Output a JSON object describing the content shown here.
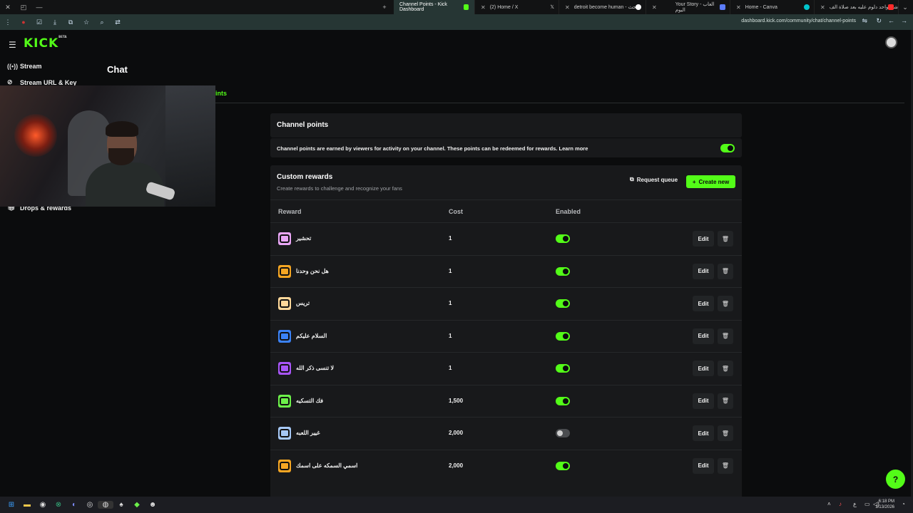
{
  "browser": {
    "tabs": [
      {
        "label": "Channel Points - Kick Dashboard",
        "active": true,
        "favicon_color": "#53fc18"
      },
      {
        "label": "(2) Home / X",
        "active": false,
        "favicon_color": "#ffffff"
      },
      {
        "label": "detroit become human - بحث",
        "active": false,
        "favicon_color": "#ffffff"
      },
      {
        "label": "Your Story - العاب اليوم",
        "active": false,
        "favicon_color": "#5b7cfa"
      },
      {
        "label": "Home - Canva",
        "active": false,
        "favicon_color": "#00c4cc"
      },
      {
        "label": "شرا واحد دلوم عليه بعد صلاة الف...",
        "active": false,
        "favicon_color": "#ff2a2a"
      }
    ],
    "new_tab": "+",
    "url": "dashboard.kick.com/community/chat/channel-points"
  },
  "app": {
    "logo": "KICK",
    "logo_badge": "BETA",
    "accent": "#53fc18",
    "sidebar": {
      "items": [
        {
          "label": "Stream",
          "icon": "broadcast-icon"
        },
        {
          "label": "Stream URL & Key",
          "icon": "link-icon"
        },
        {
          "label": "Drops & rewards",
          "icon": "gift-icon"
        }
      ]
    },
    "page_title": "Chat",
    "active_tab_label": "ints"
  },
  "channel_points": {
    "title": "Channel points",
    "description": "Channel points are earned by viewers for activity on your channel. These points can be redeemed for rewards. Learn more",
    "enabled": true
  },
  "custom_rewards": {
    "title": "Custom rewards",
    "subtitle": "Create rewards to challenge and recognize your fans",
    "request_queue_label": "Request queue",
    "create_label": "Create new",
    "columns": {
      "reward": "Reward",
      "cost": "Cost",
      "enabled": "Enabled"
    },
    "edit_label": "Edit",
    "rows": [
      {
        "name": "تحشير",
        "cost": "1",
        "enabled": true,
        "color": "#e9a6f5"
      },
      {
        "name": "هل نحن وحدنا",
        "cost": "1",
        "enabled": true,
        "color": "#f5a623"
      },
      {
        "name": "تريس",
        "cost": "1",
        "enabled": true,
        "color": "#ffd89a"
      },
      {
        "name": "السلام عليكم",
        "cost": "1",
        "enabled": true,
        "color": "#3b82f6"
      },
      {
        "name": "لا تنسى ذكر الله",
        "cost": "1",
        "enabled": true,
        "color": "#a855f7"
      },
      {
        "name": "فك التسكيه",
        "cost": "1,500",
        "enabled": true,
        "color": "#6cf04a"
      },
      {
        "name": "غيير اللعبه",
        "cost": "2,000",
        "enabled": false,
        "color": "#a6c8f5"
      },
      {
        "name": "اسمي السمكه على اسمك",
        "cost": "2,000",
        "enabled": true,
        "color": "#f5a623"
      }
    ]
  },
  "taskbar": {
    "time": "6:18 PM",
    "date": "1/13/2026",
    "lang": "ع"
  }
}
